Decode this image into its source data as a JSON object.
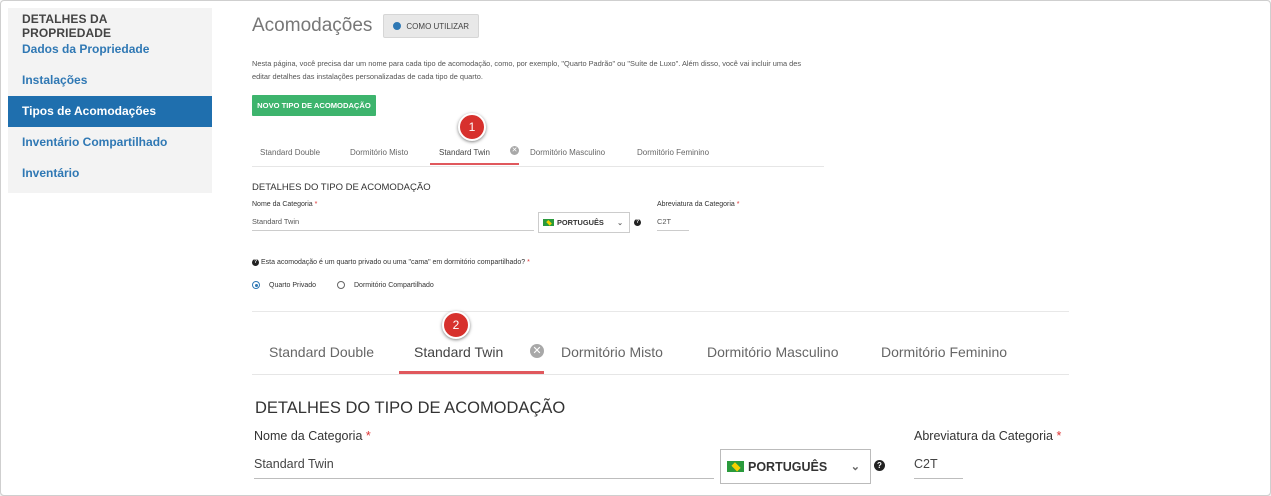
{
  "sidebar": {
    "header": "DETALHES DA PROPRIEDADE",
    "items": [
      {
        "label": "Dados da Propriedade",
        "active": false
      },
      {
        "label": "Instalações",
        "active": false
      },
      {
        "label": "Tipos de Acomodações",
        "active": true
      },
      {
        "label": "Inventário Compartilhado",
        "active": false
      },
      {
        "label": "Inventário",
        "active": false
      }
    ]
  },
  "header": {
    "title": "Acomodações",
    "howto_label": "COMO UTILIZAR"
  },
  "intro": {
    "line1": "Nesta página, você precisa dar um nome para cada tipo de acomodação, como, por exemplo, \"Quarto Padrão\" ou \"Suíte de Luxo\". Além disso, você vai incluir uma des",
    "line2": "editar detalhes das instalações personalizadas de cada tipo de quarto."
  },
  "new_button": "NOVO TIPO DE ACOMODAÇÃO",
  "tabs_small": [
    "Standard Double",
    "Dormitório Misto",
    "Standard Twin",
    "Dormitório Masculino",
    "Dormitório Feminino"
  ],
  "tabs_large": [
    "Standard Double",
    "Standard Twin",
    "Dormitório Misto",
    "Dormitório Masculino",
    "Dormitório Feminino"
  ],
  "close_glyph": "✕",
  "badges": {
    "one": "1",
    "two": "2"
  },
  "details": {
    "section_title": "DETALHES DO TIPO DE ACOMODAÇÃO",
    "name_label": "Nome da Categoria",
    "name_value": "Standard Twin",
    "language": "PORTUGUÊS",
    "abbr_label": "Abreviatura da Categoria",
    "abbr_value": "C2T",
    "required_mark": "*",
    "question": "Esta acomodação é um quarto privado ou uma \"cama\" em dormitório compartilhado?",
    "options": [
      "Quarto Privado",
      "Dormitório Compartilhado"
    ],
    "selected_option": "Quarto Privado"
  },
  "icons": {
    "chevron": "chevron-down-icon",
    "help": "question-circle-icon",
    "close": "close-circle-icon",
    "flag": "brazil-flag-icon"
  },
  "colors": {
    "accent_blue": "#1f6fae",
    "green_button": "#3db46d",
    "tab_underline": "#e0585d",
    "badge_red": "#d7312d"
  }
}
